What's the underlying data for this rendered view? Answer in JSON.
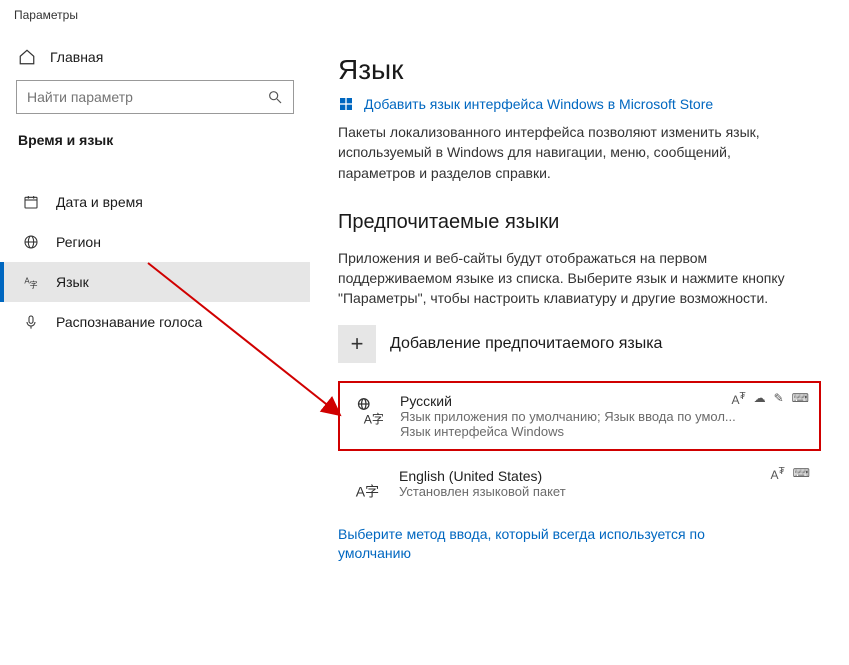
{
  "window_title": "Параметры",
  "sidebar": {
    "home": "Главная",
    "search_placeholder": "Найти параметр",
    "section": "Время и язык",
    "items": [
      {
        "label": "Дата и время"
      },
      {
        "label": "Регион"
      },
      {
        "label": "Язык"
      },
      {
        "label": "Распознавание голоса"
      }
    ]
  },
  "content": {
    "heading": "Язык",
    "store_link": "Добавить язык интерфейса Windows в Microsoft Store",
    "desc": "Пакеты локализованного интерфейса позволяют изменить язык, используемый в Windows для навигации, меню, сообщений, параметров и разделов справки.",
    "pref_heading": "Предпочитаемые языки",
    "pref_desc": "Приложения и веб-сайты будут отображаться на первом поддерживаемом языке из списка. Выберите язык и нажмите кнопку \"Параметры\", чтобы настроить клавиатуру и другие возможности.",
    "add_label": "Добавление предпочитаемого языка",
    "languages": [
      {
        "name": "Русский",
        "sub": "Язык приложения по умолчанию; Язык ввода по умол...",
        "sub2": "Язык интерфейса Windows"
      },
      {
        "name": "English (United States)",
        "sub": "Установлен языковой пакет",
        "sub2": ""
      }
    ],
    "ime_link": "Выберите метод ввода, который всегда используется по умолчанию"
  }
}
